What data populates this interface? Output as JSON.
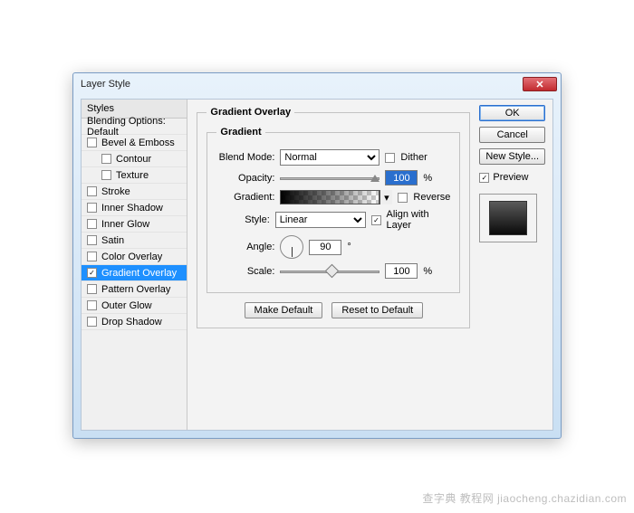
{
  "dialog": {
    "title": "Layer Style"
  },
  "sidebar": {
    "header": "Styles",
    "items": [
      {
        "label": "Blending Options: Default",
        "checked": false,
        "type": "head"
      },
      {
        "label": "Bevel & Emboss",
        "checked": false
      },
      {
        "label": "Contour",
        "checked": false,
        "sub": true
      },
      {
        "label": "Texture",
        "checked": false,
        "sub": true
      },
      {
        "label": "Stroke",
        "checked": false
      },
      {
        "label": "Inner Shadow",
        "checked": false
      },
      {
        "label": "Inner Glow",
        "checked": false
      },
      {
        "label": "Satin",
        "checked": false
      },
      {
        "label": "Color Overlay",
        "checked": false
      },
      {
        "label": "Gradient Overlay",
        "checked": true,
        "selected": true
      },
      {
        "label": "Pattern Overlay",
        "checked": false
      },
      {
        "label": "Outer Glow",
        "checked": false
      },
      {
        "label": "Drop Shadow",
        "checked": false
      }
    ]
  },
  "main": {
    "group_title": "Gradient Overlay",
    "sub_title": "Gradient",
    "blend_label": "Blend Mode:",
    "blend_value": "Normal",
    "dither_label": "Dither",
    "opacity_label": "Opacity:",
    "opacity_value": "100",
    "opacity_unit": "%",
    "gradient_label": "Gradient:",
    "reverse_label": "Reverse",
    "style_label": "Style:",
    "style_value": "Linear",
    "align_label": "Align with Layer",
    "angle_label": "Angle:",
    "angle_value": "90",
    "angle_unit": "°",
    "scale_label": "Scale:",
    "scale_value": "100",
    "scale_unit": "%",
    "make_default": "Make Default",
    "reset_default": "Reset to Default"
  },
  "right": {
    "ok": "OK",
    "cancel": "Cancel",
    "new_style": "New Style...",
    "preview_label": "Preview"
  },
  "watermark": "查字典 教程网  jiaocheng.chazidian.com"
}
